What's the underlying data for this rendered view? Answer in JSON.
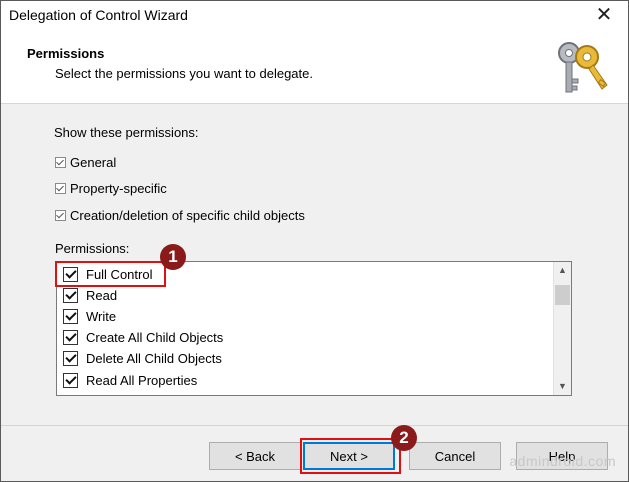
{
  "window": {
    "title": "Delegation of Control Wizard"
  },
  "header": {
    "title": "Permissions",
    "subtitle": "Select the permissions you want to delegate."
  },
  "show": {
    "label": "Show these permissions:",
    "options": [
      {
        "label": "General",
        "checked": true
      },
      {
        "label": "Property-specific",
        "checked": true
      },
      {
        "label": "Creation/deletion of specific child objects",
        "checked": true
      }
    ]
  },
  "permissions": {
    "label": "Permissions:",
    "items": [
      {
        "label": "Full Control",
        "checked": true
      },
      {
        "label": "Read",
        "checked": true
      },
      {
        "label": "Write",
        "checked": true
      },
      {
        "label": "Create All Child Objects",
        "checked": true
      },
      {
        "label": "Delete All Child Objects",
        "checked": true
      },
      {
        "label": "Read All Properties",
        "checked": true
      }
    ]
  },
  "buttons": {
    "back": "< Back",
    "next": "Next >",
    "cancel": "Cancel",
    "help": "Help"
  },
  "annotations": {
    "step1": "1",
    "step2": "2"
  },
  "watermark": "admindroid.com",
  "colors": {
    "highlight": "#e01010",
    "badge": "#8b1a1a",
    "primary_border": "#0078d7"
  }
}
